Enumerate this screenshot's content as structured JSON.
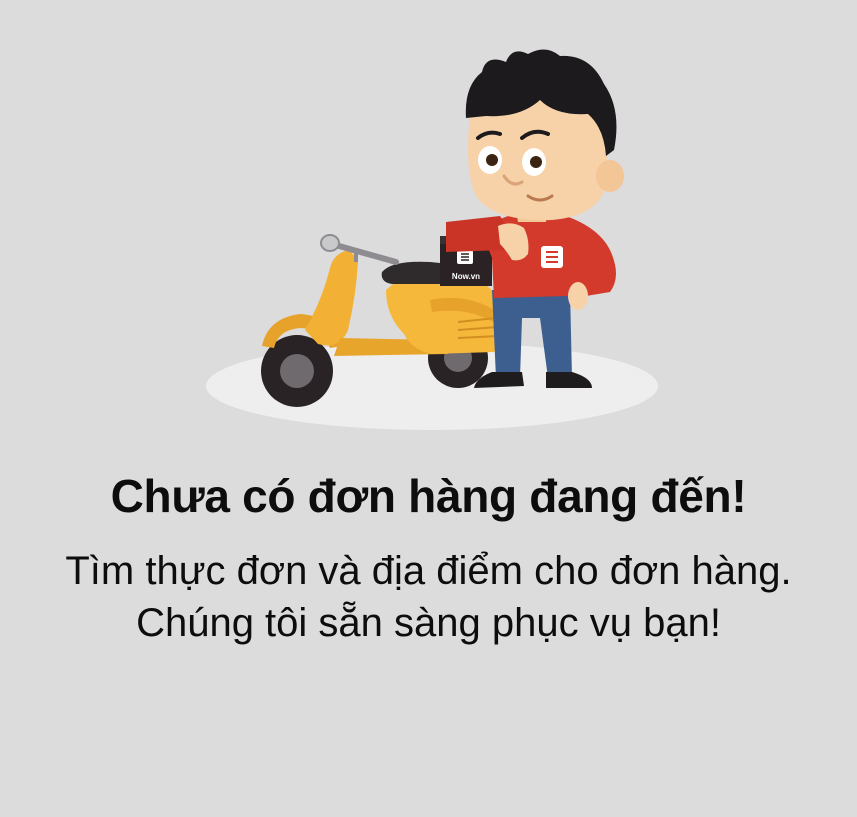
{
  "empty_state": {
    "title": "Chưa có đơn hàng đang đến!",
    "subtitle_line1": "Tìm thực đơn và địa điểm cho đơn hàng.",
    "subtitle_line2": "Chúng tôi sẵn sàng phục vụ bạn!",
    "box_brand": "Now.vn"
  },
  "colors": {
    "background": "#dcdcdc",
    "shirt": "#d33a2c",
    "scooter": "#f2b134",
    "pants": "#3d5f8f"
  }
}
